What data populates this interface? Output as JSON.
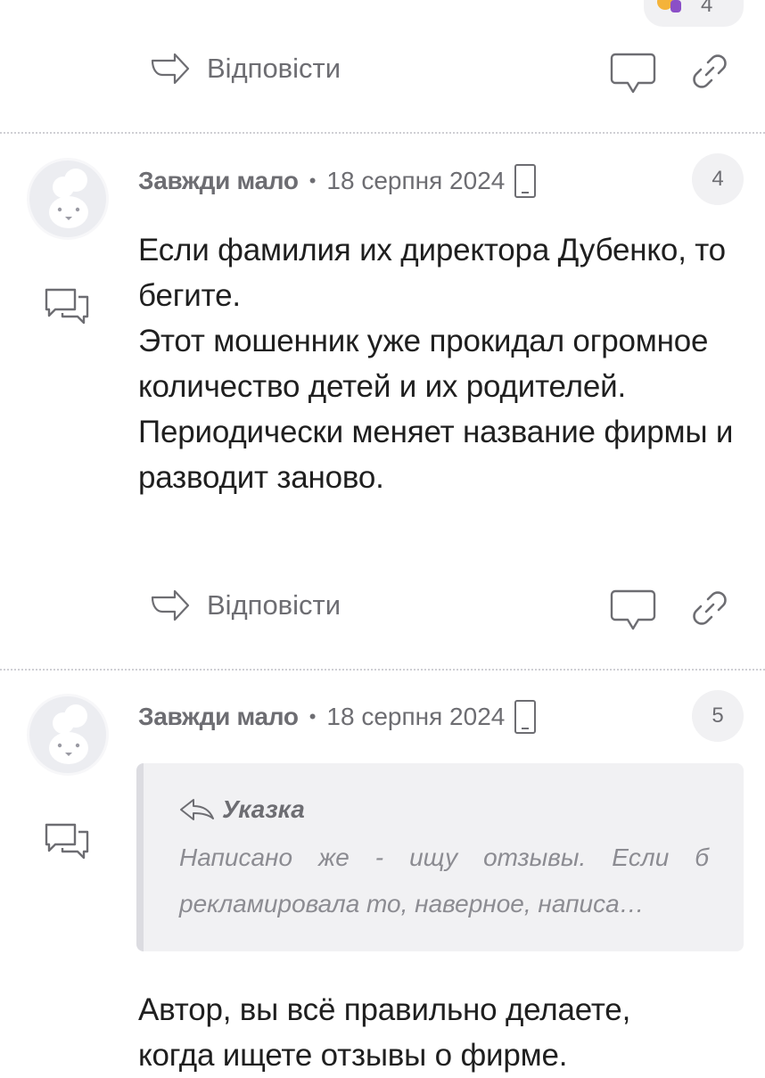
{
  "top_reaction": {
    "emoji_name": "facepalm-emoji",
    "count": "4"
  },
  "reply_label": "Відповісти",
  "comments": [
    {
      "author": "Завжди мало",
      "date": "18 серпня 2024",
      "number": "4",
      "paragraphs": [
        "Если фамилия их директора Дубенко, то бегите.",
        "Этот мошенник уже прокидал огромное количество детей и их родителей.",
        "Периодически меняет название фирмы и разводит заново."
      ]
    },
    {
      "author": "Завжди мало",
      "date": "18 серпня 2024",
      "number": "5",
      "quote": {
        "author": "Указка",
        "text": "Написано же - ищу отзывы. Если б рекламировала то, наверное, написа…"
      },
      "paragraphs": [
        "Автор, вы всё правильно делаете, когда ищете отзывы о фирме."
      ]
    }
  ],
  "colors": {
    "muted": "#6d6d72",
    "text": "#1f1f1f",
    "badge_bg": "#f1f1f3",
    "quote_bg": "#f1f1f3"
  }
}
